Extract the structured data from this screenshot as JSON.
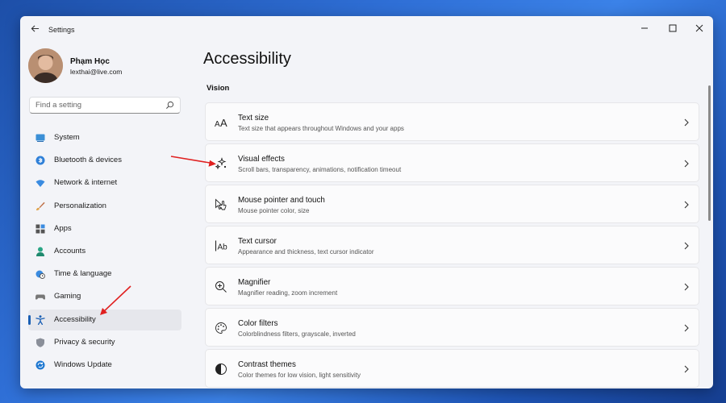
{
  "window": {
    "title": "Settings"
  },
  "colors": {
    "accent": "#1a5fb4",
    "annotation_arrow": "#e02020",
    "window_bg": "#f3f4f8"
  },
  "profile": {
    "name": "Phạm Học",
    "email": "lexthai@live.com"
  },
  "search": {
    "placeholder": "Find a setting",
    "value": ""
  },
  "sidebar": {
    "items": [
      {
        "label": "System",
        "icon": "monitor-icon"
      },
      {
        "label": "Bluetooth & devices",
        "icon": "bluetooth-icon"
      },
      {
        "label": "Network & internet",
        "icon": "wifi-icon"
      },
      {
        "label": "Personalization",
        "icon": "brush-icon"
      },
      {
        "label": "Apps",
        "icon": "apps-icon"
      },
      {
        "label": "Accounts",
        "icon": "person-icon"
      },
      {
        "label": "Time & language",
        "icon": "globe-clock-icon"
      },
      {
        "label": "Gaming",
        "icon": "gamepad-icon"
      },
      {
        "label": "Accessibility",
        "icon": "accessibility-icon",
        "active": true
      },
      {
        "label": "Privacy & security",
        "icon": "shield-icon"
      },
      {
        "label": "Windows Update",
        "icon": "refresh-icon"
      }
    ]
  },
  "main": {
    "title": "Accessibility",
    "section": "Vision",
    "cards": [
      {
        "title": "Text size",
        "subtitle": "Text size that appears throughout Windows and your apps",
        "icon": "text-size-icon"
      },
      {
        "title": "Visual effects",
        "subtitle": "Scroll bars, transparency, animations, notification timeout",
        "icon": "sparkle-icon"
      },
      {
        "title": "Mouse pointer and touch",
        "subtitle": "Mouse pointer color, size",
        "icon": "pointer-touch-icon"
      },
      {
        "title": "Text cursor",
        "subtitle": "Appearance and thickness, text cursor indicator",
        "icon": "text-cursor-icon"
      },
      {
        "title": "Magnifier",
        "subtitle": "Magnifier reading, zoom increment",
        "icon": "magnifier-icon"
      },
      {
        "title": "Color filters",
        "subtitle": "Colorblindness filters, grayscale, inverted",
        "icon": "palette-icon"
      },
      {
        "title": "Contrast themes",
        "subtitle": "Color themes for low vision, light sensitivity",
        "icon": "contrast-icon"
      }
    ]
  }
}
